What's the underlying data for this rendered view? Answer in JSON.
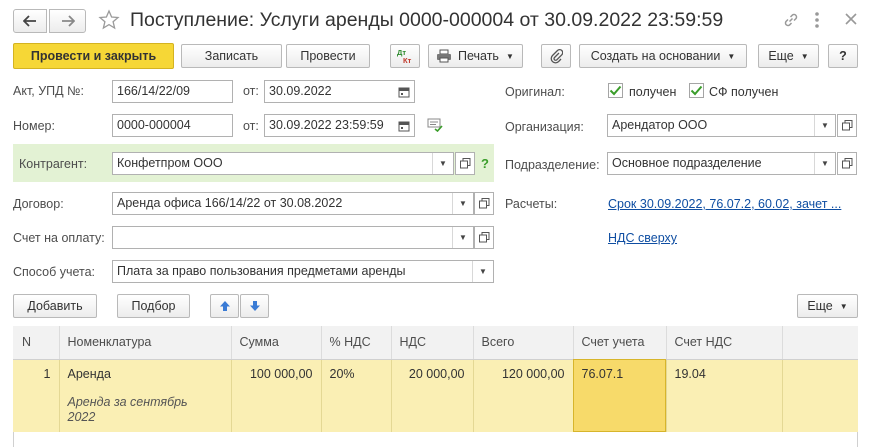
{
  "window": {
    "title": "Поступление: Услуги аренды 0000-000004 от 30.09.2022 23:59:59"
  },
  "toolbar": {
    "post_and_close": "Провести и закрыть",
    "save": "Записать",
    "post": "Провести",
    "dt_kt": "Дт Кт",
    "print": "Печать",
    "create_based_on": "Создать на основании",
    "more": "Еще",
    "help": "?"
  },
  "form": {
    "act_label": "Акт, УПД №:",
    "act_value": "166/14/22/09",
    "act_date_label": "от:",
    "act_date_value": "30.09.2022",
    "number_label": "Номер:",
    "number_value": "0000-000004",
    "number_date_label": "от:",
    "number_date_value": "30.09.2022 23:59:59",
    "counterparty_label": "Контрагент:",
    "counterparty_value": "Конфетпром ООО",
    "counterparty_help": "?",
    "contract_label": "Договор:",
    "contract_value": "Аренда офиса 166/14/22 от 30.08.2022",
    "invoice_label": "Счет на оплату:",
    "invoice_value": "",
    "accounting_label": "Способ учета:",
    "accounting_value": "Плата за право пользования предметами аренды",
    "original_label": "Оригинал:",
    "received_label": "получен",
    "received_checked": true,
    "sf_received_label": "СФ получен",
    "sf_received_checked": true,
    "organization_label": "Организация:",
    "organization_value": "Арендатор ООО",
    "division_label": "Подразделение:",
    "division_value": "Основное подразделение",
    "settlements_label": "Расчеты:",
    "settlements_link": "Срок 30.09.2022, 76.07.2, 60.02, зачет ...",
    "vat_link": "НДС сверху"
  },
  "table_toolbar": {
    "add": "Добавить",
    "pick": "Подбор",
    "more": "Еще"
  },
  "table": {
    "columns": [
      "N",
      "Номенклатура",
      "Сумма",
      "% НДС",
      "НДС",
      "Всего",
      "Счет учета",
      "Счет НДС"
    ],
    "rows": [
      {
        "n": "1",
        "item": "Аренда",
        "content": "Аренда за сентябрь 2022",
        "sum": "100 000,00",
        "vat_rate": "20%",
        "vat": "20 000,00",
        "total": "120 000,00",
        "account": "76.07.1",
        "vat_account": "19.04"
      }
    ]
  },
  "colors": {
    "accent_yellow": "#f6d736",
    "row_highlight": "#faefb4",
    "selected_cell": "#f7da6a",
    "counterparty_bg": "#e3f2d4",
    "link": "#0f4ea2",
    "check_green": "#3a9d2a"
  }
}
